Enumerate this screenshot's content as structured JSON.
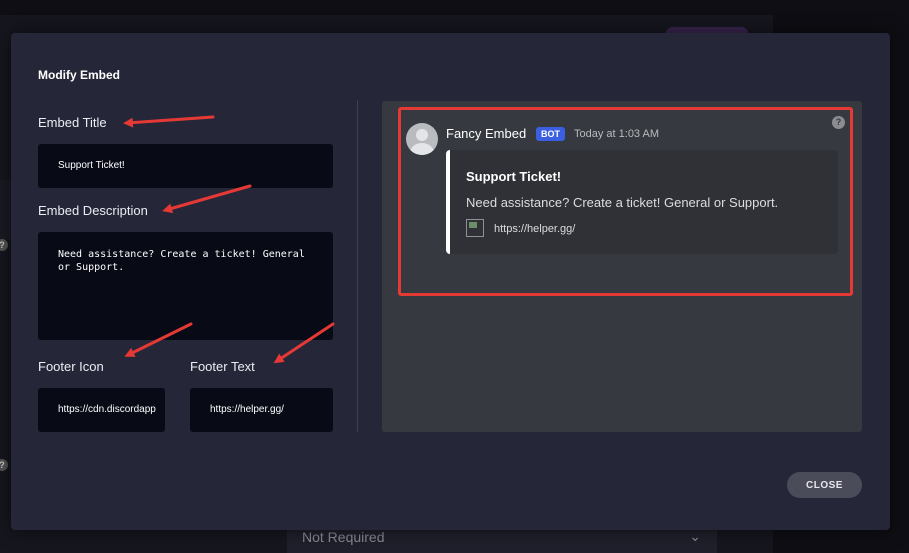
{
  "modal": {
    "title": "Modify Embed",
    "close_label": "CLOSE"
  },
  "form": {
    "title_label": "Embed Title",
    "title_value": "Support Ticket!",
    "description_label": "Embed Description",
    "description_value": "Need assistance? Create a ticket! General or Support.",
    "footer_icon_label": "Footer Icon",
    "footer_icon_value": "https://cdn.discordapp",
    "footer_text_label": "Footer Text",
    "footer_text_value": "https://helper.gg/"
  },
  "preview": {
    "bot_name": "Fancy Embed",
    "bot_badge": "BOT",
    "timestamp": "Today at 1:03 AM",
    "help": "?",
    "embed_title": "Support Ticket!",
    "embed_description": "Need assistance? Create a ticket! General or Support.",
    "embed_footer": "https://helper.gg/"
  },
  "background": {
    "select_value": "Not Required",
    "help_marker": "?"
  },
  "colors": {
    "modal_bg": "#252638",
    "field_bg": "#080a16",
    "preview_bg": "#36393f",
    "highlight": "#e53935",
    "arrow": "#e53935",
    "bot_badge": "#3b5fe0"
  }
}
